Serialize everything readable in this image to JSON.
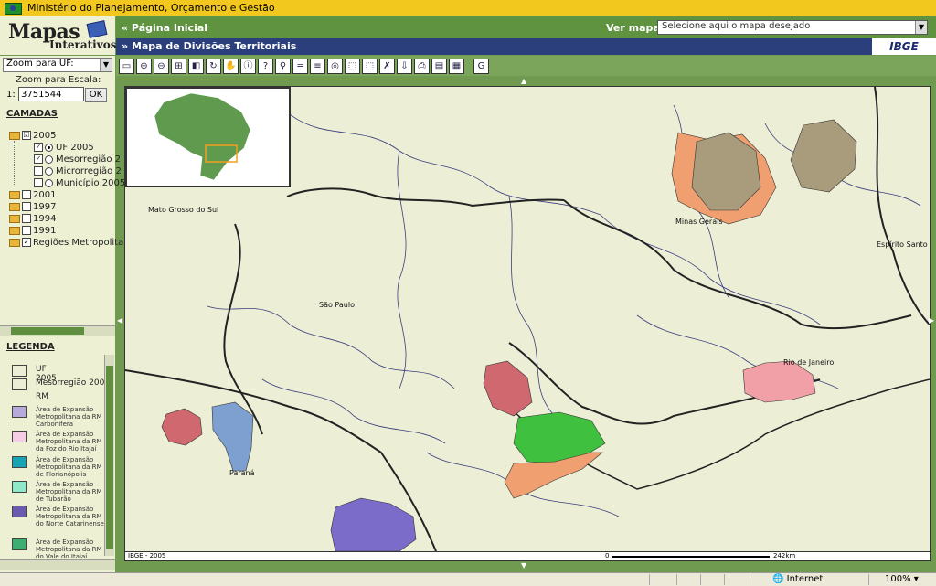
{
  "top_bar": {
    "title": "Ministério do Planejamento, Orçamento e Gestão"
  },
  "logo": {
    "line1": "Mapas",
    "line2": "Interativos"
  },
  "sidebar": {
    "zoom_uf_label": "Zoom para UF:",
    "zoom_scale_label": "Zoom para Escala:",
    "scale_prefix": "1:",
    "scale_value": "3751544",
    "ok_label": "OK",
    "layers_title": "CAMADAS",
    "layers": [
      {
        "label": "2005"
      },
      {
        "label": "UF 2005"
      },
      {
        "label": "Mesorregião 2"
      },
      {
        "label": "Microrregião 2"
      },
      {
        "label": "Município 2005"
      },
      {
        "label": "2001"
      },
      {
        "label": "1997"
      },
      {
        "label": "1994"
      },
      {
        "label": "1991"
      },
      {
        "label": "Regiões Metropolita"
      }
    ],
    "legend_title": "LEGENDA",
    "legend": [
      {
        "label": "UF 2005",
        "color": "#eceed6"
      },
      {
        "label": "Mesorregião 2005",
        "color": "#eceed6"
      },
      {
        "label": "RM",
        "color": ""
      },
      {
        "label": "Área de Expansão Metropolitana da RM Carbonífera",
        "color": "#b7a9d9"
      },
      {
        "label": "Área de Expansão Metropolitana da RM da Foz do Rio Itajaí",
        "color": "#f5cde4"
      },
      {
        "label": "Área de Expansão Metropolitana da RM de Florianópolis",
        "color": "#18a3b6"
      },
      {
        "label": "Área de Expansão Metropolitana da RM de Tubarão",
        "color": "#8fe8c8"
      },
      {
        "label": "Área de Expansão Metropolitana da RM do Norte Catarinense",
        "color": "#6a5ab0"
      },
      {
        "label": "Área de Expansão Metropolitana da RM do Vale do Itajaí",
        "color": "#3fae73"
      }
    ]
  },
  "header": {
    "home_label": "« Página Inicial",
    "map_label": "Ver mapa:",
    "map_select_placeholder": "Selecione aqui o mapa desejado",
    "map_title": "Mapa de Divisões Territoriais",
    "ibge_logo": "IBGE"
  },
  "toolbar": {
    "tools": [
      "full-extent-icon",
      "zoom-in-icon",
      "zoom-out-icon",
      "zoom-window-icon",
      "zoom-previous-icon",
      "refresh-icon",
      "pan-hand-icon",
      "info-icon",
      "query-icon",
      "find-icon",
      "measure-icon",
      "layers-icon",
      "locate-icon",
      "select-icon",
      "select-area-icon",
      "clear-selection-icon",
      "download-icon",
      "print-icon",
      "report-icon",
      "legend-icon",
      "google-icon"
    ]
  },
  "map": {
    "labels": {
      "mato_grosso_do_sul": "Mato Grosso do Sul",
      "minas_gerais": "Minas Gerais",
      "espirito_santo": "Espírito Santo",
      "sao_paulo": "São Paulo",
      "rio_de_janeiro": "Rio de Janeiro",
      "parana": "Paraná"
    },
    "footer_left": "IBGE - 2005",
    "scale_start": "0",
    "scale_end": "242km"
  },
  "statusbar": {
    "zone": "Internet",
    "zoom": "100%"
  }
}
